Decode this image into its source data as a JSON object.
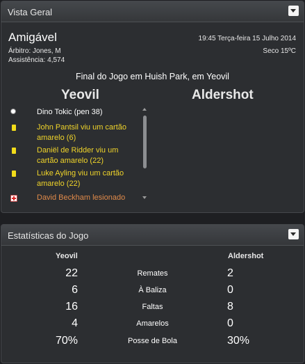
{
  "overview": {
    "title": "Vista Geral",
    "competition": "Amigável",
    "referee": "Árbitro: Jones, M",
    "attendance": "Assistência: 4,574",
    "datetime": "19:45 Terça-feira 15 Julho 2014",
    "weather": "Seco 15ºC",
    "summary": "Final do Jogo em Huish Park, em Yeovil",
    "home_team": "Yeovil",
    "away_team": "Aldershot",
    "events": [
      {
        "icon": "goal-ball-icon",
        "text": "Dino Tokic (pen 38)"
      },
      {
        "icon": "yellow-card-icon",
        "text": "John Pantsil viu um cartão amarelo (6)"
      },
      {
        "icon": "yellow-card-icon",
        "text": "Daniël de Ridder viu um cartão amarelo (22)"
      },
      {
        "icon": "yellow-card-icon",
        "text": "Luke Ayling viu um cartão amarelo (22)"
      },
      {
        "icon": "injury-icon",
        "text": "David Beckham lesionado"
      }
    ]
  },
  "stats": {
    "title": "Estatísticas do Jogo",
    "home_team": "Yeovil",
    "away_team": "Aldershot",
    "rows": [
      {
        "label": "Remates",
        "home": "22",
        "away": "2"
      },
      {
        "label": "À Baliza",
        "home": "6",
        "away": "0"
      },
      {
        "label": "Faltas",
        "home": "16",
        "away": "8"
      },
      {
        "label": "Amarelos",
        "home": "4",
        "away": "0"
      },
      {
        "label": "Posse de Bola",
        "home": "70%",
        "away": "30%"
      }
    ]
  },
  "colors": {
    "background": "#1e1f22",
    "panel": "#2c2e31",
    "yellow_text": "#f0d42a",
    "injury_text": "#e08a4a",
    "card": "#f2dc1a"
  }
}
